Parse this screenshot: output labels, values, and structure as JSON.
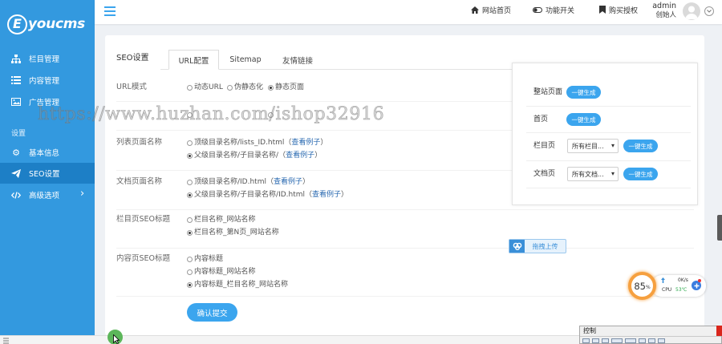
{
  "app": {
    "logo_initial": "E",
    "logo_rest": "youcms"
  },
  "sidebar": {
    "items": [
      {
        "label": "栏目管理",
        "icon": "sitemap-icon"
      },
      {
        "label": "内容管理",
        "icon": "list-icon"
      },
      {
        "label": "广告管理",
        "icon": "image-icon"
      }
    ],
    "section_title": "设置",
    "settings_items": [
      {
        "label": "基本信息",
        "icon": "gear-icon"
      },
      {
        "label": "SEO设置",
        "icon": "paper-plane-icon",
        "active": true
      },
      {
        "label": "高级选项",
        "icon": "code-icon",
        "has_submenu": true
      }
    ]
  },
  "header": {
    "menu_icon": "hamburger-icon",
    "links": [
      {
        "label": "网站首页",
        "icon": "home-icon"
      },
      {
        "label": "功能开关",
        "icon": "toggle-icon"
      },
      {
        "label": "购买授权",
        "icon": "bookmark-icon"
      }
    ],
    "user": {
      "name": "admin",
      "role": "创始人",
      "avatar_icon": "user-avatar-icon",
      "menu_icon": "chevron-down-icon"
    }
  },
  "page": {
    "title": "SEO设置",
    "tabs": [
      {
        "label": "URL配置",
        "active": true
      },
      {
        "label": "Sitemap",
        "active": false
      },
      {
        "label": "友情链接",
        "active": false
      }
    ]
  },
  "form": {
    "url_mode": {
      "label": "URL模式",
      "options": [
        "动态URL",
        "伪静态化",
        "静态页面"
      ],
      "selected_index": 2
    },
    "list_page_name": {
      "label": "列表页面名称",
      "options": [
        {
          "text": "顶级目录名称/lists_ID.html（",
          "link": "查看例子",
          "suffix": "）"
        },
        {
          "text": "父级目录名称/子目录名称/（",
          "link": "查看例子",
          "suffix": "）"
        }
      ],
      "selected_index": 1
    },
    "doc_page_name": {
      "label": "文档页面名称",
      "options": [
        {
          "text": "顶级目录名称/ID.html（",
          "link": "查看例子",
          "suffix": "）"
        },
        {
          "text": "父级目录名称/子目录名称/ID.html（",
          "link": "查看例子",
          "suffix": "）"
        }
      ],
      "selected_index": 1
    },
    "column_seo_title": {
      "label": "栏目页SEO标题",
      "options": [
        "栏目名称_网站名称",
        "栏目名称_第N页_网站名称"
      ],
      "selected_index": 1
    },
    "content_seo_title": {
      "label": "内容页SEO标题",
      "options": [
        "内容标题",
        "内容标题_网站名称",
        "内容标题_栏目名称_网站名称"
      ],
      "selected_index": 2
    },
    "submit_label": "确认提交"
  },
  "generate_panel": {
    "rows": [
      {
        "label": "整站页面",
        "button": "一键生成"
      },
      {
        "label": "首页",
        "button": "一键生成"
      },
      {
        "label": "栏目页",
        "select": "所有栏目...",
        "button": "一键生成"
      },
      {
        "label": "文档页",
        "select": "所有文档...",
        "button": "一键生成"
      }
    ]
  },
  "upload_widget": {
    "label": "拖拽上传",
    "icon": "cloud-upload-icon"
  },
  "cpu_widget": {
    "percent": "85",
    "percent_unit": "%",
    "speed": "0K/s",
    "cpu_label": "CPU",
    "temp": "53℃",
    "icon": "plus-circle-icon"
  },
  "control_window": {
    "title": "控制"
  },
  "watermark": "https://www.huzhan.com/ishop32916",
  "colors": {
    "sidebar": "#3399df",
    "sidebar_active": "#1d7fc6",
    "accent": "#3ba5ee",
    "link": "#2868b0",
    "cpu_ring": "#f6a03f",
    "cpu_temp": "#2aa84a",
    "upload": "#3a8fd8",
    "page_bg": "#eef1f5"
  }
}
